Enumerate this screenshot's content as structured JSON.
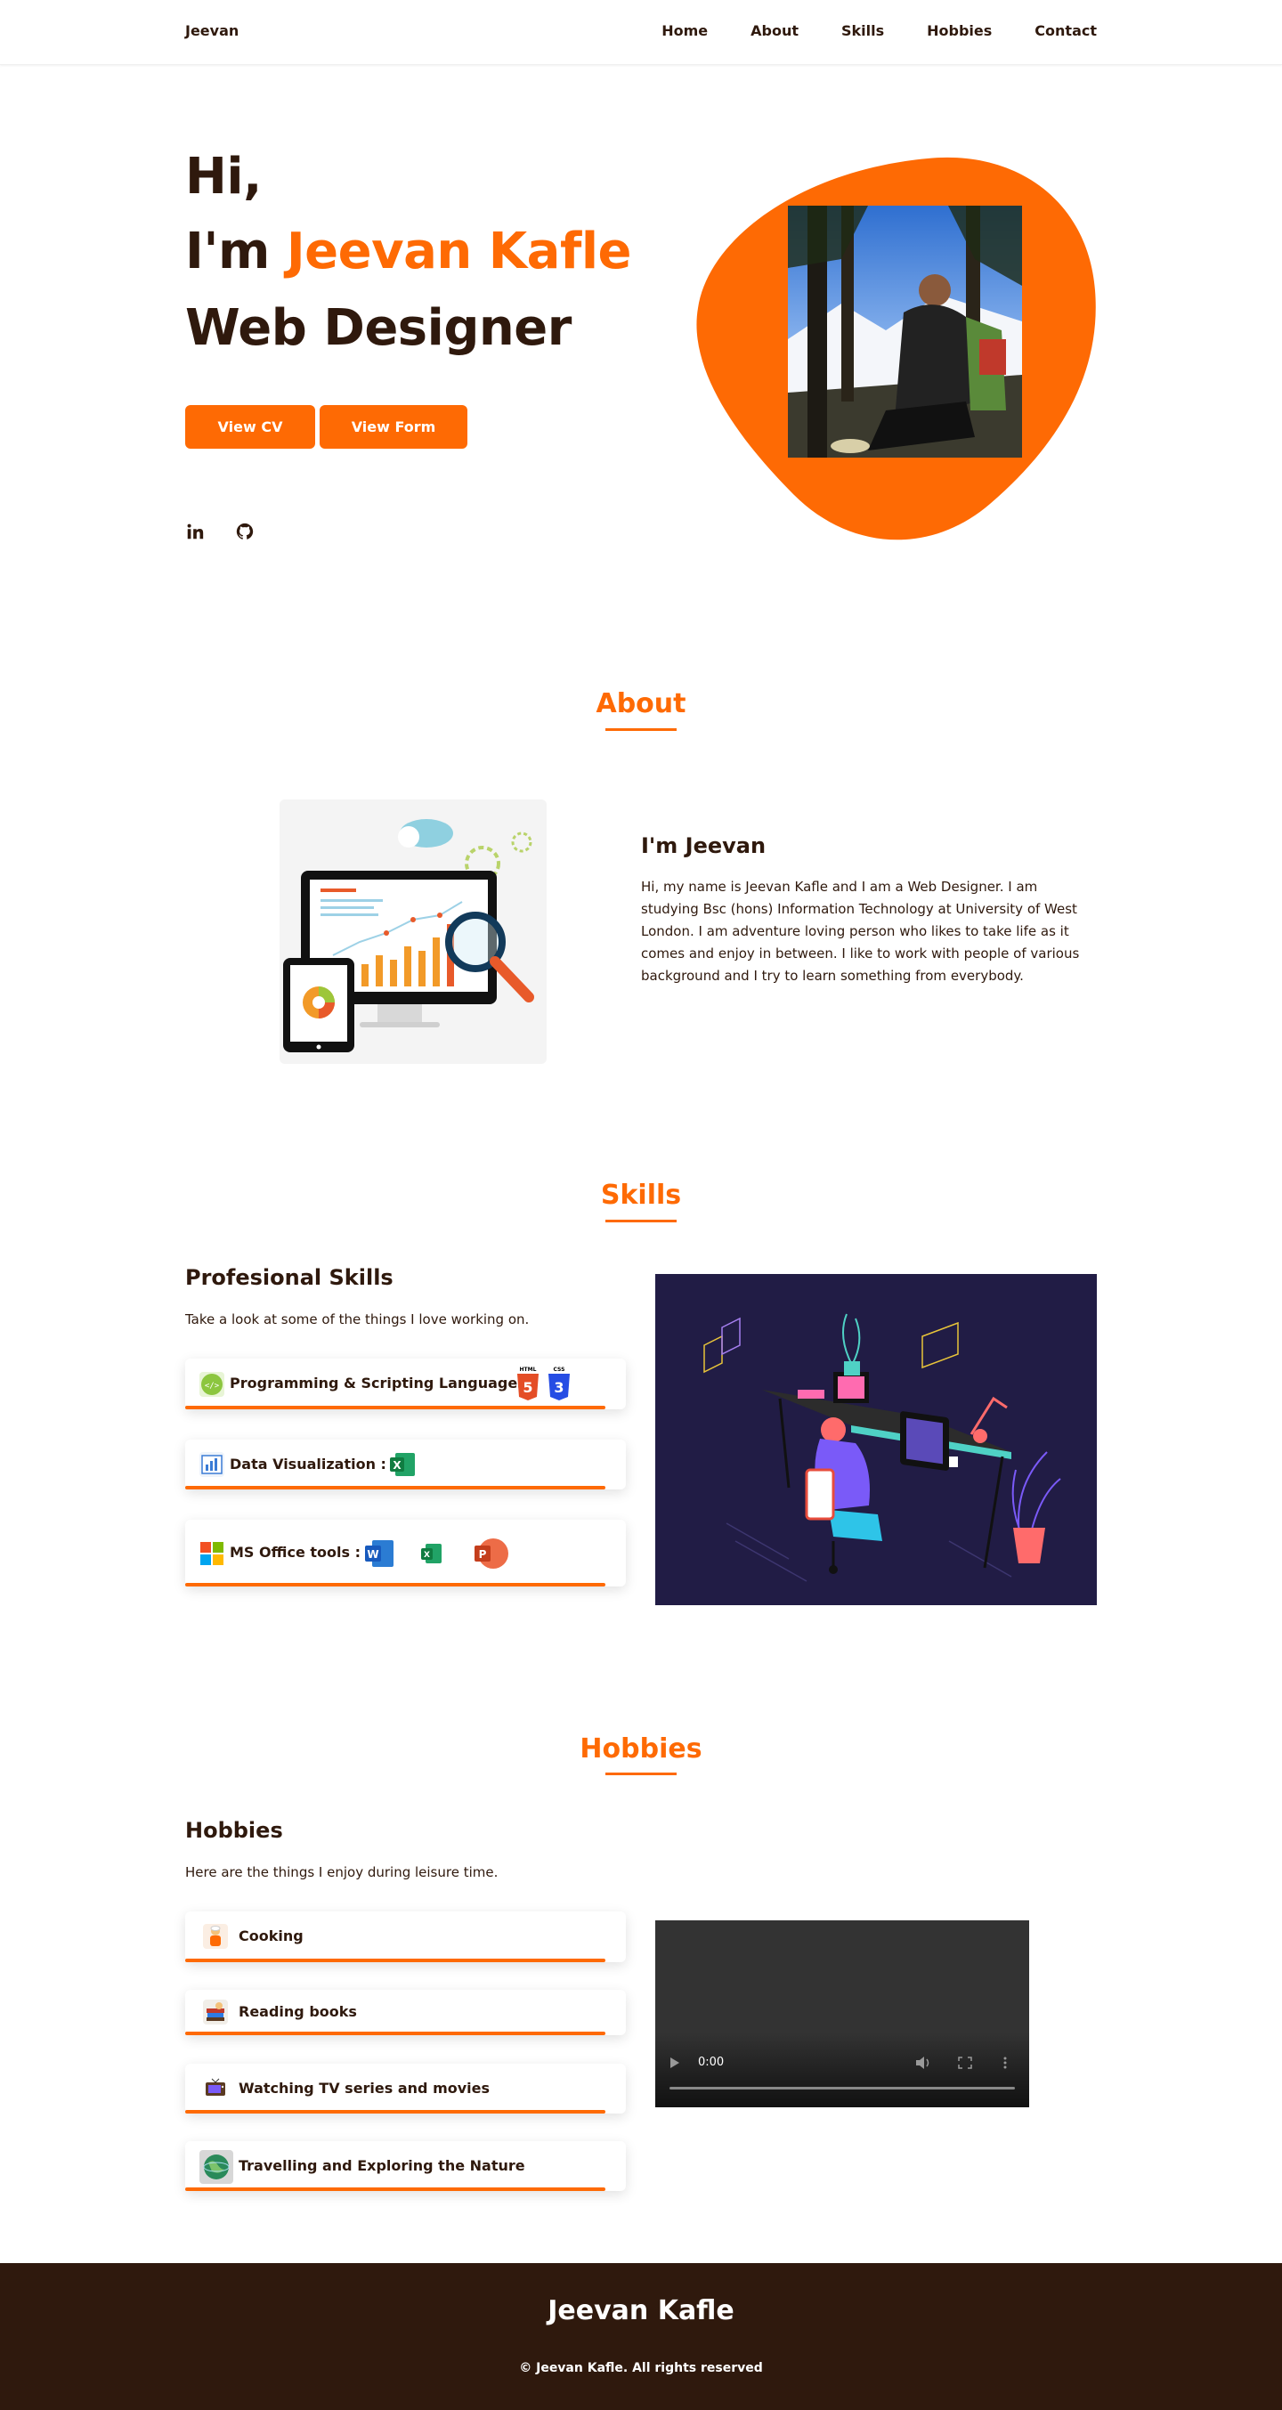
{
  "header": {
    "logo": "Jeevan",
    "nav": [
      "Home",
      "About",
      "Skills",
      "Hobbies",
      "Contact"
    ]
  },
  "hero": {
    "line1": "Hi,",
    "line2_prefix": "I'm ",
    "line2_name": "Jeevan Kafle",
    "line3": "Web Designer",
    "buttons": [
      "View CV",
      "View Form"
    ],
    "social_icons": [
      "linkedin-icon",
      "github-icon"
    ]
  },
  "about": {
    "title": "About",
    "heading": "I'm Jeevan",
    "text": "Hi, my name is Jeevan Kafle and I am a Web Designer. I am studying Bsc (hons) Information Technology at University of West London. I am adventure loving person who likes to take life as it comes and enjoy in between. I like to work with people of various background and I try to learn something from everybody."
  },
  "skills": {
    "title": "Skills",
    "heading": "Profesional Skills",
    "subtitle": "Take a look at some of the things I love working on.",
    "items": [
      {
        "label": "Programming & Scripting Languages:",
        "icons": [
          "html5-icon",
          "css3-icon"
        ]
      },
      {
        "label": "Data Visualization :",
        "icons": [
          "excel-icon"
        ]
      },
      {
        "label": "MS Office tools :",
        "icons": [
          "word-icon",
          "excel-icon",
          "powerpoint-icon"
        ]
      }
    ]
  },
  "hobbies": {
    "title": "Hobbies",
    "heading": "Hobbies",
    "subtitle": "Here are the things I enjoy during leisure time.",
    "items": [
      "Cooking",
      "Reading books",
      "Watching TV series and movies",
      "Travelling and Exploring the Nature"
    ],
    "video_time": "0:00"
  },
  "footer": {
    "title": "Jeevan Kafle",
    "copyright": "© Jeevan Kafle. All rights reserved"
  },
  "colors": {
    "accent": "#fe6a04",
    "dark": "#2f190d"
  }
}
